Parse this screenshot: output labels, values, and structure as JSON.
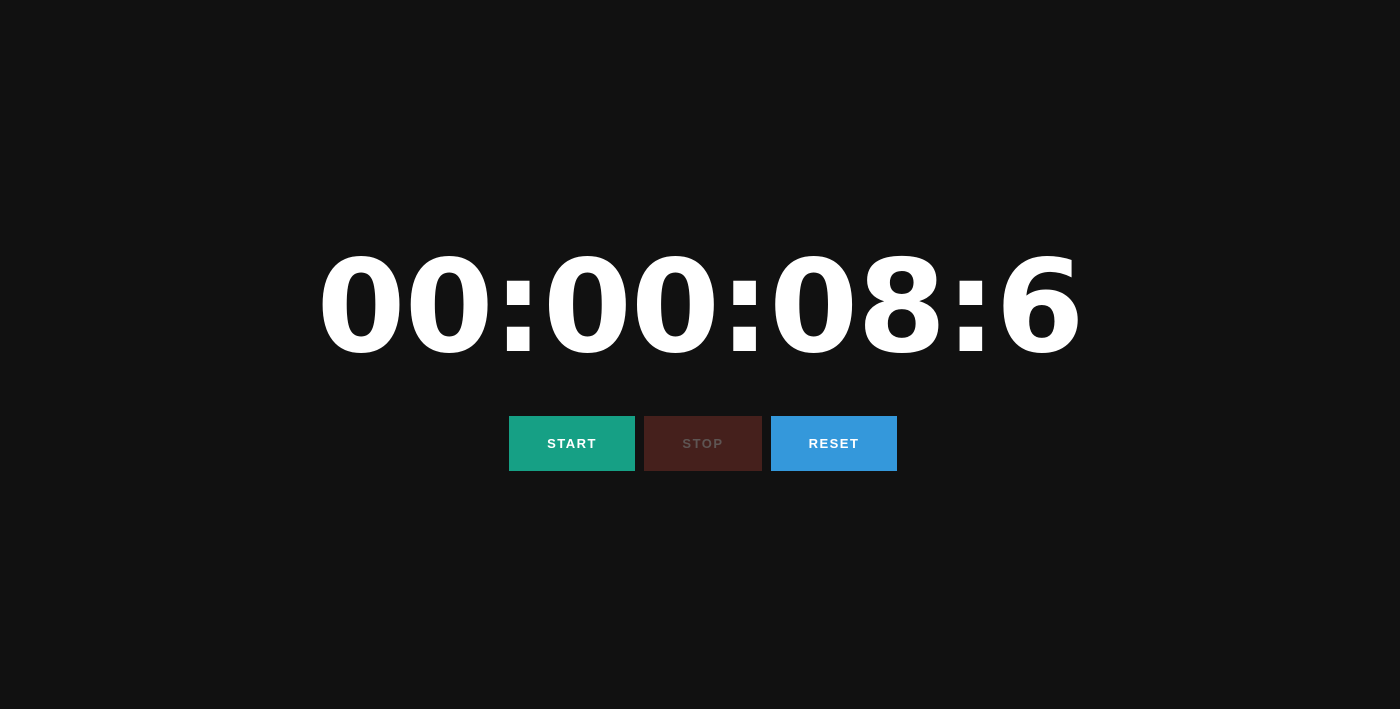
{
  "timer": {
    "display": "00:00:08:6"
  },
  "controls": {
    "start": {
      "label": "START",
      "bg": "#16A085",
      "fg": "#FFFFFF"
    },
    "stop": {
      "label": "STOP",
      "bg": "#45201C",
      "fg": "#5E5553"
    },
    "reset": {
      "label": "RESET",
      "bg": "#3498DB",
      "fg": "#FFFFFF"
    }
  },
  "theme": {
    "background": "#111111",
    "timer_color": "#FFFFFF"
  }
}
